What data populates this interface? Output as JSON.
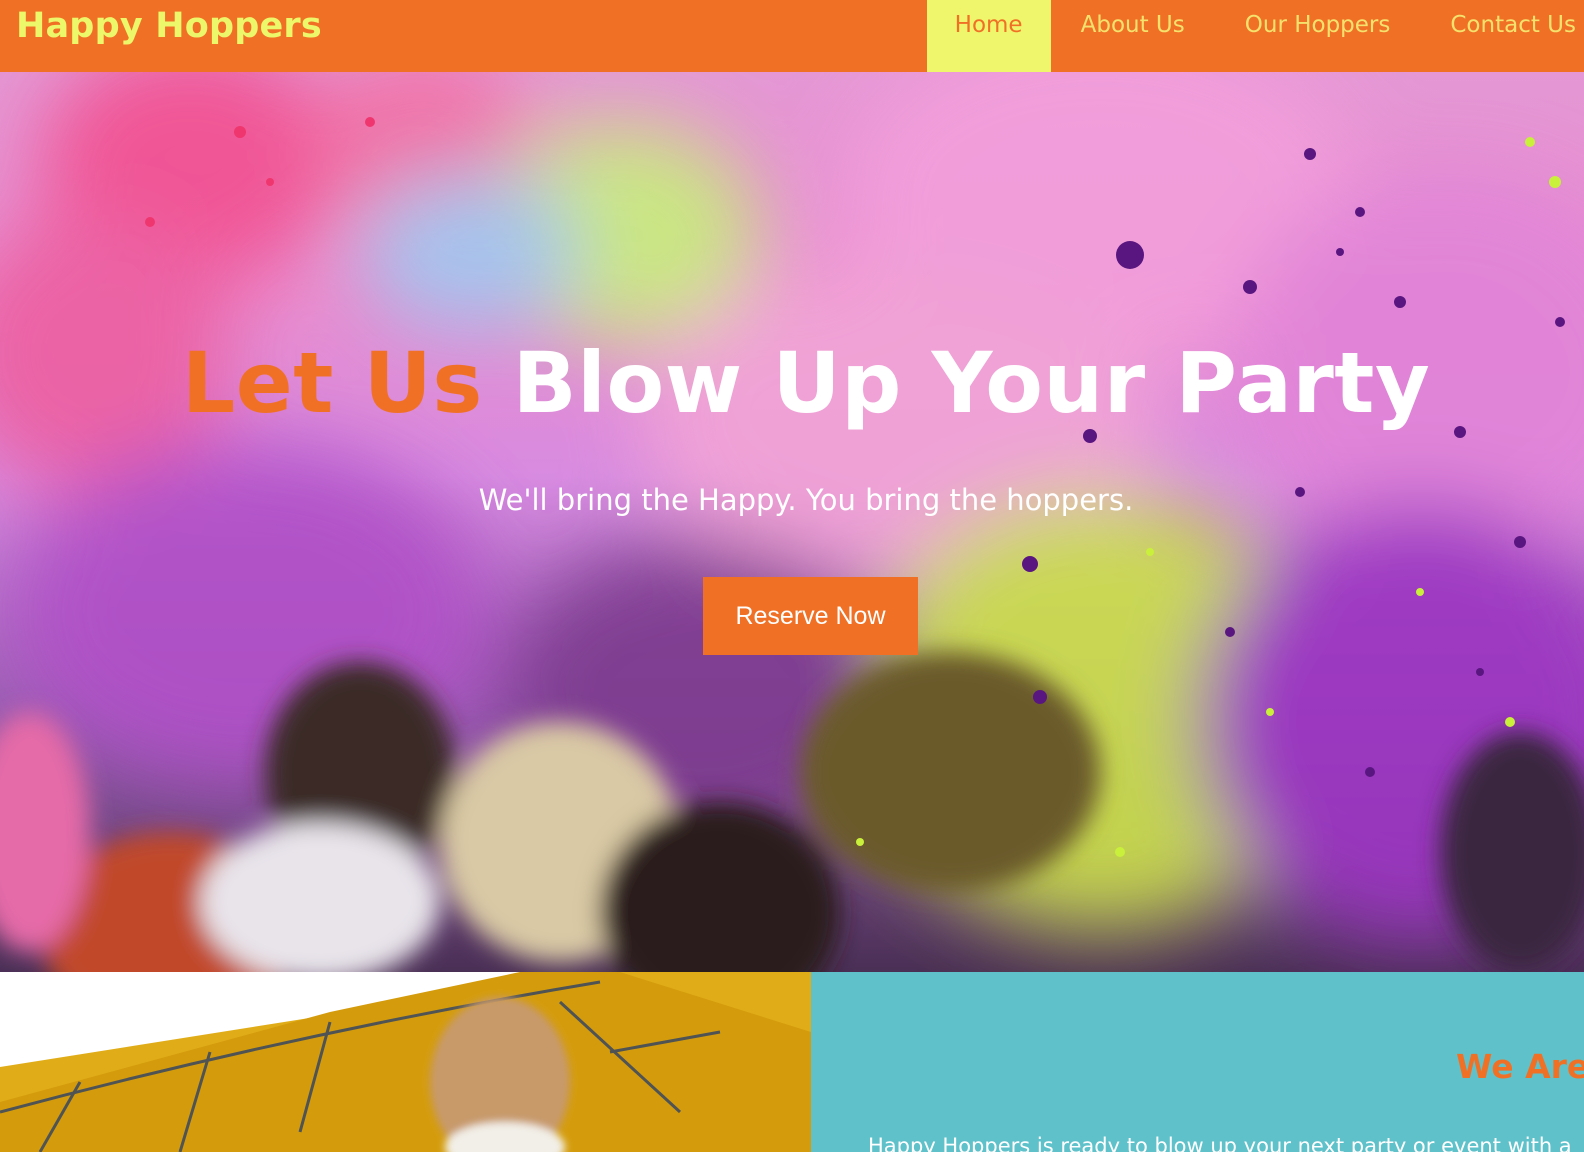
{
  "brand": {
    "name": "Happy Hoppers"
  },
  "nav": {
    "items": [
      {
        "label": "Home",
        "active": true
      },
      {
        "label": "About Us",
        "active": false
      },
      {
        "label": "Our Hoppers",
        "active": false
      },
      {
        "label": "Contact Us",
        "active": false
      }
    ]
  },
  "hero": {
    "headline_accent": "Let Us",
    "headline_rest": "Blow Up Your Party",
    "subtitle": "We'll bring the Happy. You bring the hoppers.",
    "cta_label": "Reserve Now",
    "image": "color-powder-party-crowd"
  },
  "about": {
    "image": "bounce-house-child",
    "title": "We Are",
    "text": "Happy Hoppers is ready to blow up your next party or event with a"
  },
  "colors": {
    "brand_orange": "#f07126",
    "nav_yellow": "#eff66c",
    "logo_yellow": "#edf76a",
    "teal": "#5fc2cb",
    "white": "#ffffff"
  }
}
